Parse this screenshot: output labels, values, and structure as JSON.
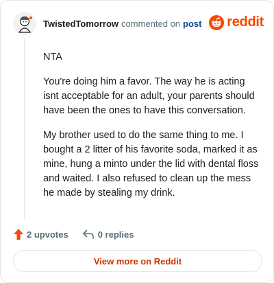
{
  "comment": {
    "author": "TwistedTomorrow",
    "action": "commented on",
    "target": "post",
    "paragraphs": [
      "NTA",
      "You're doing him a favor. The way he is acting isnt acceptable for an adult, your parents should have been the ones to have this conversation.",
      "My brother used to do the same thing to me. I bought a 2 litter of his favorite soda, marked it as mine, hung a minto under the lid with dental floss and waited. I also refused to clean up the mess he made by stealing my drink."
    ]
  },
  "brand": {
    "name": "reddit",
    "icon": "reddit-logo-icon",
    "color": "#ff4500"
  },
  "footer": {
    "upvotes": "2 upvotes",
    "replies": "0 replies",
    "upvote_icon": "upvote-arrow-icon",
    "reply_icon": "reply-arrow-icon"
  },
  "view_more": "View more on Reddit"
}
